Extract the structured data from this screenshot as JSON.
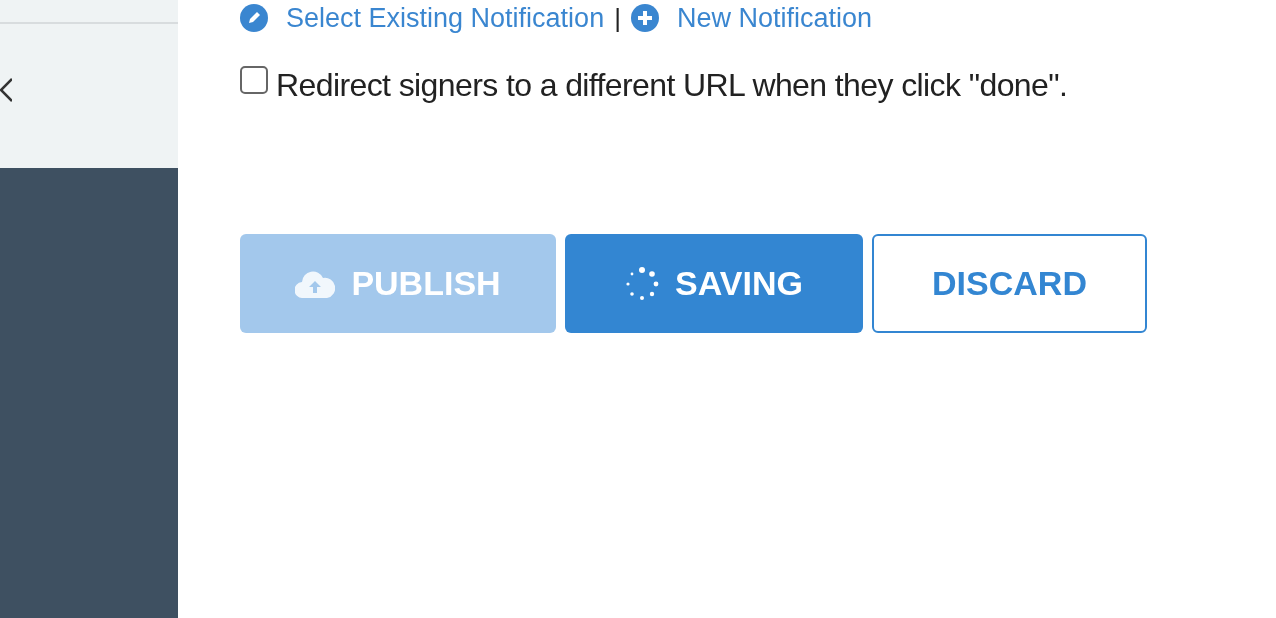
{
  "links": [
    {
      "label": "Select Existing Notification",
      "kind": "edit"
    },
    {
      "label": "New Notification",
      "kind": "add"
    }
  ],
  "separator": "|",
  "redirect": {
    "label": "Redirect signers to a different URL when they click \"done\".",
    "checked": false
  },
  "buttons": [
    {
      "label": "PUBLISH",
      "kind": "upload",
      "disabled": true
    },
    {
      "label": "SAVING",
      "kind": "busy",
      "disabled": false
    },
    {
      "label": "DISCARD",
      "kind": "outline",
      "disabled": false
    }
  ]
}
